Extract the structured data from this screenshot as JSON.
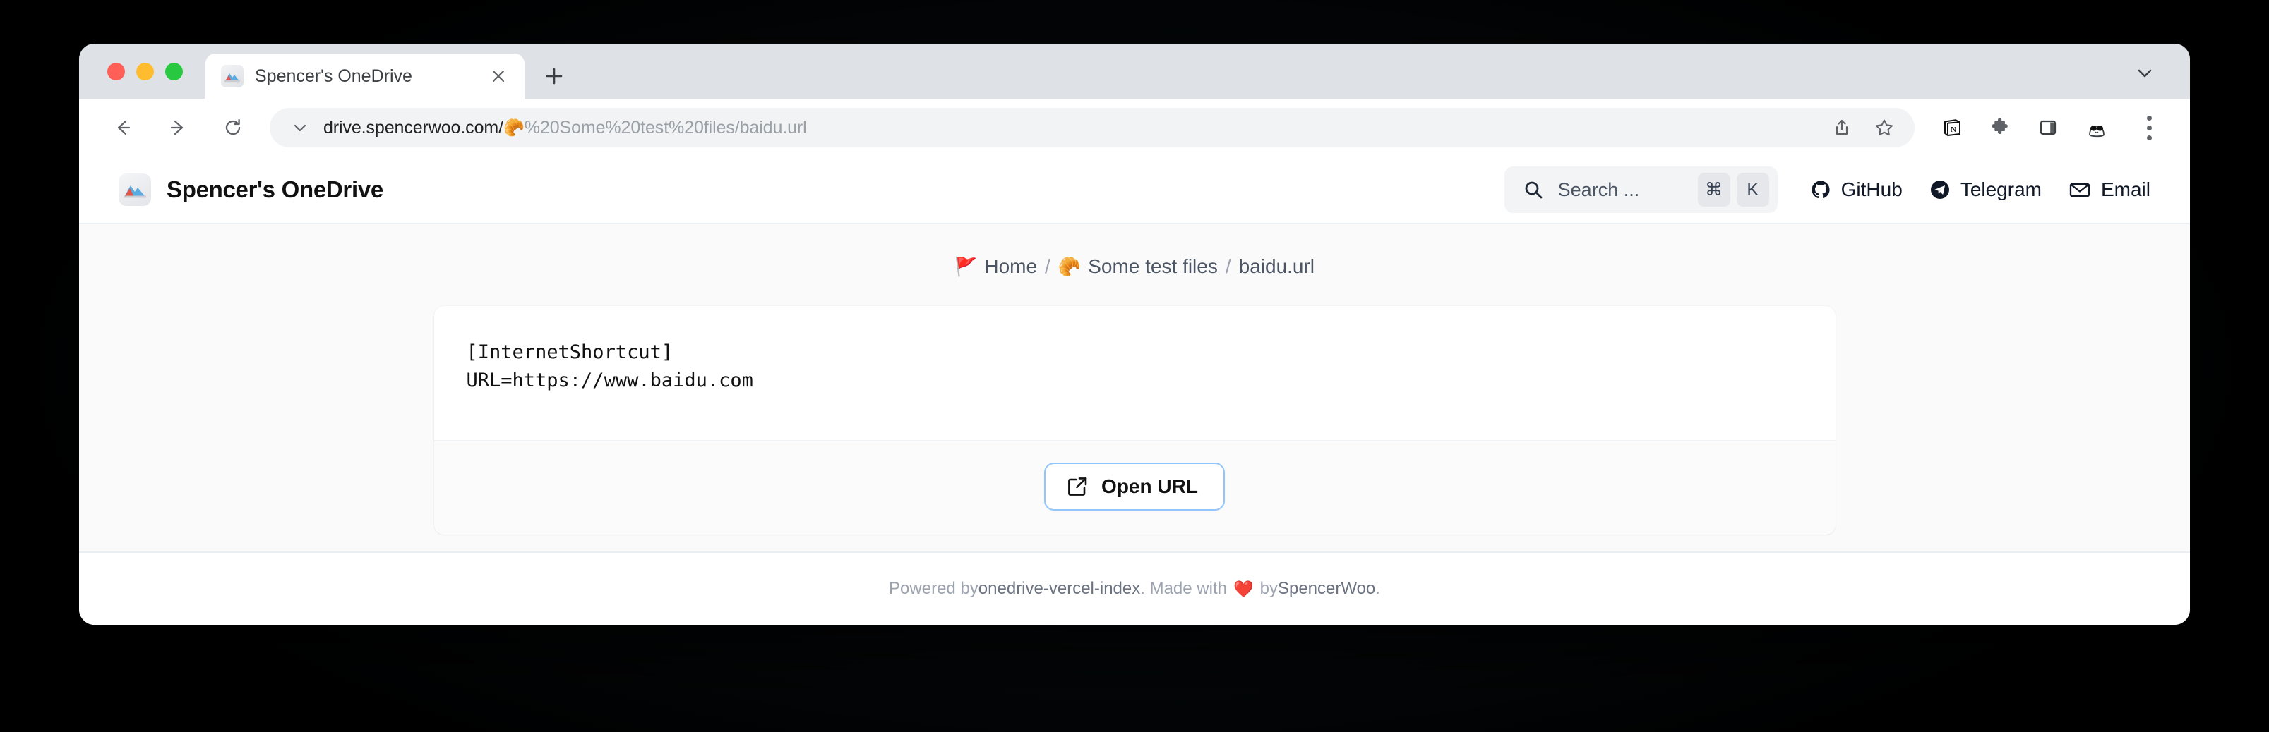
{
  "browser": {
    "traffic_lights": [
      "close",
      "minimize",
      "maximize"
    ],
    "tab": {
      "title": "Spencer's OneDrive",
      "favicon": "mountain-image-icon",
      "close_label": "✕"
    },
    "new_tab_label": "+",
    "tab_list_icon": "chevron-down-icon",
    "toolbar": {
      "back_icon": "arrow-left-icon",
      "forward_icon": "arrow-right-icon",
      "reload_icon": "reload-icon",
      "omnibox_chevron_icon": "chevron-down-icon",
      "url_domain": "drive.spencerwoo.com/",
      "url_emoji": "🥐",
      "url_path": "%20Some%20test%20files/baidu.url",
      "share_icon": "share-icon",
      "bookmark_icon": "star-icon",
      "notion_icon": "notion-extension-icon",
      "extensions_icon": "puzzle-piece-icon",
      "side_panel_icon": "side-panel-icon",
      "avatar_icon": "profile-avatar-icon",
      "menu_icon": "three-dot-menu-icon"
    }
  },
  "site": {
    "brand": {
      "logo": "mountain-image-icon",
      "title": "Spencer's OneDrive"
    },
    "search": {
      "icon": "search-icon",
      "placeholder": "Search ...",
      "keys": [
        "⌘",
        "K"
      ]
    },
    "links": [
      {
        "label": "GitHub",
        "icon": "github-icon"
      },
      {
        "label": "Telegram",
        "icon": "telegram-icon"
      },
      {
        "label": "Email",
        "icon": "envelope-icon"
      }
    ],
    "breadcrumb": {
      "home_emoji": "🚩",
      "home_label": "Home",
      "separator": "/",
      "folder_emoji": "🥐",
      "folder_label": "Some test files",
      "current_label": "baidu.url"
    },
    "file": {
      "name": "baidu.url",
      "preview_text": "[InternetShortcut]\nURL=https://www.baidu.com",
      "action_button": {
        "label": "Open URL",
        "icon": "external-link-icon"
      }
    },
    "footer": {
      "prefix": "Powered by ",
      "project": "onedrive-vercel-index",
      "middle": ". Made with ",
      "heart": "❤️",
      "suffix": " by ",
      "author": "SpencerWoo",
      "period": "."
    }
  },
  "colors": {
    "accent_border": "#93c5fd",
    "page_background": "#fafafa",
    "card_background": "#ffffff",
    "browser_chrome": "#dee1e6"
  }
}
